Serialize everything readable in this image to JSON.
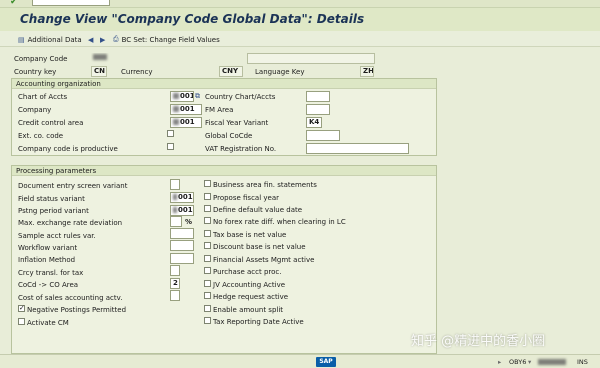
{
  "title": "Change View \"Company Code Global Data\": Details",
  "toolbar": {
    "additional_data": "Additional Data",
    "bc_set": "BC Set: Change Field Values"
  },
  "header": {
    "company_code_label": "Company Code",
    "country_key_label": "Country key",
    "country_key_value": "CN",
    "currency_label": "Currency",
    "currency_value": "CNY",
    "language_key_label": "Language Key",
    "language_key_value": "ZH"
  },
  "accounting": {
    "title": "Accounting organization",
    "chart_of_accts_label": "Chart of Accts",
    "chart_of_accts_value": "001",
    "company_label": "Company",
    "company_value": "001",
    "credit_control_label": "Credit control area",
    "credit_control_value": "001",
    "ext_co_code_label": "Ext. co. code",
    "productive_label": "Company code is productive",
    "country_chart_label": "Country Chart/Accts",
    "fm_area_label": "FM Area",
    "fiscal_year_variant_label": "Fiscal Year Variant",
    "fiscal_year_variant_value": "K4",
    "global_cocde_label": "Global CoCde",
    "vat_reg_label": "VAT Registration No."
  },
  "processing": {
    "title": "Processing parameters",
    "doc_entry_label": "Document entry screen variant",
    "field_status_label": "Field status variant",
    "field_status_value": "001",
    "posting_period_label": "Pstng period variant",
    "posting_period_value": "001",
    "max_exch_label": "Max. exchange rate deviation",
    "max_exch_unit": "%",
    "sample_acct_label": "Sample acct rules var.",
    "workflow_label": "Workflow variant",
    "inflation_label": "Inflation Method",
    "crcy_transl_label": "Crcy transl. for tax",
    "cocd_co_label": "CoCd -> CO Area",
    "cocd_co_value": "2",
    "cost_sales_label": "Cost of sales accounting actv.",
    "negative_postings_label": "Negative Postings Permitted",
    "activate_cm_label": "Activate CM",
    "right_options": [
      "Business area fin. statements",
      "Propose fiscal year",
      "Define default value date",
      "No forex rate diff. when clearing in LC",
      "Tax base is net value",
      "Discount base is net value",
      "Financial Assets Mgmt active",
      "Purchase acct proc.",
      "JV Accounting Active",
      "Hedge request active",
      "Enable amount split",
      "Tax Reporting Date Active"
    ]
  },
  "status": {
    "system": "OBY6",
    "mode": "INS"
  },
  "watermark": "知乎 @精进中的香小圈"
}
